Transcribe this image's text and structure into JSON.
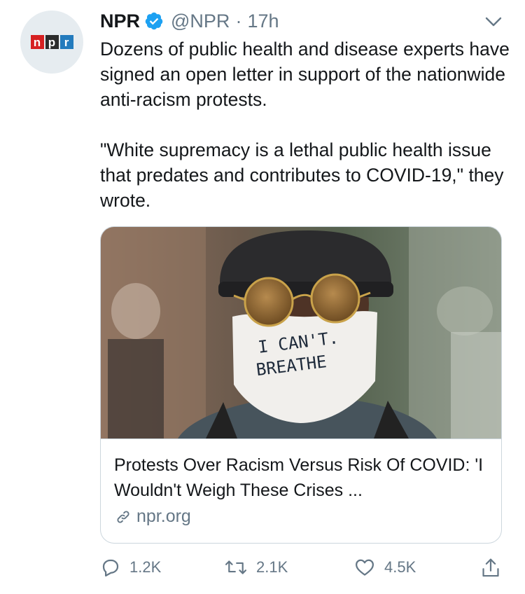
{
  "tweet": {
    "author_name": "NPR",
    "handle": "@NPR",
    "separator": "·",
    "time": "17h",
    "logo_letters": [
      "n",
      "p",
      "r"
    ],
    "logo_colors": [
      "#d62021",
      "#2c2c2c",
      "#237bbd"
    ],
    "text_paragraphs": [
      "Dozens of public health and disease experts have signed an open letter in support of the nationwide anti-racism protests.",
      "\"White supremacy is a lethal public health issue that predates and contributes to COVID-19,\" they wrote."
    ]
  },
  "card": {
    "image_mask_text_line1": "I CAN'T.",
    "image_mask_text_line2": "BREATHE",
    "title": "Protests Over Racism Versus Risk Of COVID: 'I Wouldn't Weigh These Crises ...",
    "domain": "npr.org"
  },
  "actions": {
    "replies": "1.2K",
    "retweets": "2.1K",
    "likes": "4.5K"
  },
  "colors": {
    "verified_blue": "#1da1f2",
    "muted": "#657786",
    "border": "#ccd6dd"
  },
  "icons": [
    "verified-badge-icon",
    "chevron-down-icon",
    "link-icon",
    "reply-icon",
    "retweet-icon",
    "like-icon",
    "share-icon"
  ]
}
